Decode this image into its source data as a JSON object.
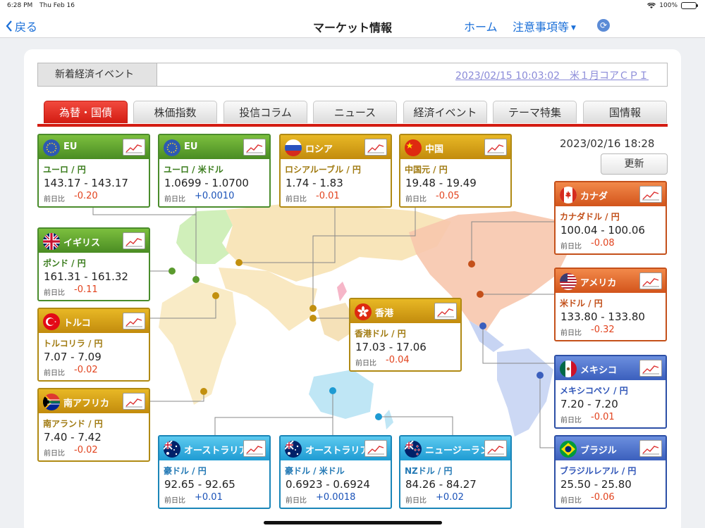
{
  "status_bar": {
    "time": "6:28 PM",
    "date": "Thu Feb 16",
    "battery": "100%"
  },
  "nav": {
    "back_label": "戻る",
    "title": "マーケット情報",
    "home_label": "ホーム",
    "notice_label": "注意事項等"
  },
  "event": {
    "label": "新着経済イベント",
    "link_text": "2023/02/15 10:03:02　米１月コアＣＰＩ"
  },
  "tabs": [
    "為替・国債",
    "株価指数",
    "投信コラム",
    "ニュース",
    "経済イベント",
    "テーマ特集",
    "国情報"
  ],
  "timestamp": "2023/02/16 18:28",
  "update_label": "更新",
  "change_label": "前日比",
  "colors": {
    "accent_red": "#d31c12",
    "link_blue": "#1a6fd8",
    "negative": "#e2431e",
    "positive": "#1a52b8"
  },
  "cards": [
    {
      "country": "EU",
      "flag": "eu",
      "pair": "ユーロ / 円",
      "rate": "143.17 - 143.17",
      "change": "-0.20",
      "dir": "neg"
    },
    {
      "country": "EU",
      "flag": "eu",
      "pair": "ユーロ / 米ドル",
      "rate": "1.0699 - 1.0700",
      "change": "+0.0010",
      "dir": "pos"
    },
    {
      "country": "ロシア",
      "flag": "russia",
      "pair": "ロシアルーブル / 円",
      "rate": "1.74 - 1.83",
      "change": "-0.01",
      "dir": "neg"
    },
    {
      "country": "中国",
      "flag": "china",
      "pair": "中国元 / 円",
      "rate": "19.48 - 19.49",
      "change": "-0.05",
      "dir": "neg"
    },
    {
      "country": "イギリス",
      "flag": "uk",
      "pair": "ポンド / 円",
      "rate": "161.31 - 161.32",
      "change": "-0.11",
      "dir": "neg"
    },
    {
      "country": "トルコ",
      "flag": "turkey",
      "pair": "トルコリラ / 円",
      "rate": "7.07 - 7.09",
      "change": "-0.02",
      "dir": "neg"
    },
    {
      "country": "南アフリカ",
      "flag": "south-africa",
      "pair": "南アランド / 円",
      "rate": "7.40 - 7.42",
      "change": "-0.02",
      "dir": "neg"
    },
    {
      "country": "香港",
      "flag": "hong-kong",
      "pair": "香港ドル / 円",
      "rate": "17.03 - 17.06",
      "change": "-0.04",
      "dir": "neg"
    },
    {
      "country": "カナダ",
      "flag": "canada",
      "pair": "カナダドル / 円",
      "rate": "100.04 - 100.06",
      "change": "-0.08",
      "dir": "neg"
    },
    {
      "country": "アメリカ",
      "flag": "usa",
      "pair": "米ドル / 円",
      "rate": "133.80 - 133.80",
      "change": "-0.32",
      "dir": "neg"
    },
    {
      "country": "メキシコ",
      "flag": "mexico",
      "pair": "メキシコペソ / 円",
      "rate": "7.20 - 7.20",
      "change": "-0.01",
      "dir": "neg"
    },
    {
      "country": "ブラジル",
      "flag": "brazil",
      "pair": "ブラジルレアル / 円",
      "rate": "25.50 - 25.80",
      "change": "-0.06",
      "dir": "neg"
    },
    {
      "country": "オーストラリア",
      "flag": "australia",
      "pair": "豪ドル / 円",
      "rate": "92.65 - 92.65",
      "change": "+0.01",
      "dir": "pos"
    },
    {
      "country": "オーストラリア",
      "flag": "australia",
      "pair": "豪ドル / 米ドル",
      "rate": "0.6923 - 0.6924",
      "change": "+0.0018",
      "dir": "pos"
    },
    {
      "country": "ニュージーランド",
      "flag": "new-zealand",
      "pair": "NZドル / 円",
      "rate": "84.26 - 84.27",
      "change": "+0.02",
      "dir": "pos"
    }
  ]
}
